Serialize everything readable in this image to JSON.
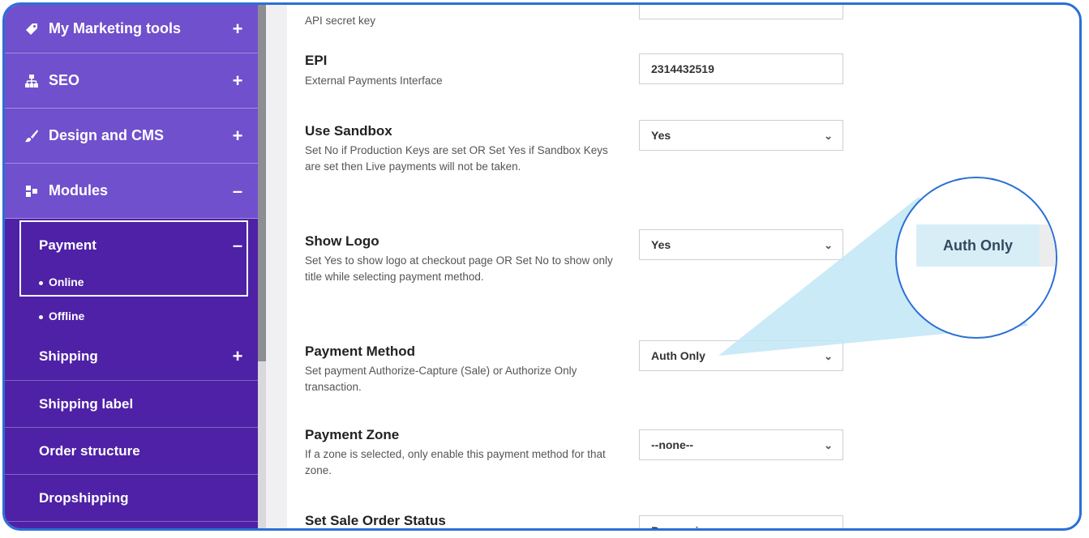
{
  "sidebar": {
    "items": [
      {
        "label": "My Marketing tools",
        "toggle": "+"
      },
      {
        "label": "SEO",
        "toggle": "+"
      },
      {
        "label": "Design and CMS",
        "toggle": "+"
      },
      {
        "label": "Modules",
        "toggle": "–"
      }
    ],
    "payment": {
      "label": "Payment",
      "toggle": "–",
      "subitems": [
        "Online",
        "Offline"
      ]
    },
    "sections": [
      {
        "label": "Shipping",
        "toggle": "+"
      },
      {
        "label": "Shipping label"
      },
      {
        "label": "Order structure"
      },
      {
        "label": "Dropshipping"
      }
    ]
  },
  "form": {
    "api_secret_label": "API secret key",
    "epi": {
      "title": "EPI",
      "desc": "External Payments Interface",
      "value": "2314432519"
    },
    "use_sandbox": {
      "title": "Use Sandbox",
      "desc": "Set No if Production Keys are set OR Set Yes if Sandbox Keys are set then Live payments will not be taken.",
      "value": "Yes"
    },
    "show_logo": {
      "title": "Show Logo",
      "desc": "Set Yes to show logo at checkout page OR Set No to show only title while selecting payment method.",
      "value": "Yes"
    },
    "payment_method": {
      "title": "Payment Method",
      "desc": "Set payment Authorize-Capture (Sale) or Authorize Only transaction.",
      "value": "Auth Only"
    },
    "payment_zone": {
      "title": "Payment Zone",
      "desc": "If a zone is selected, only enable this payment method for that zone.",
      "value": "--none--"
    },
    "sale_order_status": {
      "title": "Set Sale Order Status",
      "value": "Processing"
    }
  },
  "magnifier": {
    "label": "Auth Only"
  },
  "colors": {
    "frame": "#2b6fd6",
    "sidebar": "#6a3fc8",
    "sidebar_active": "#4e21a6",
    "zoom_fill": "#bfe6f5"
  }
}
